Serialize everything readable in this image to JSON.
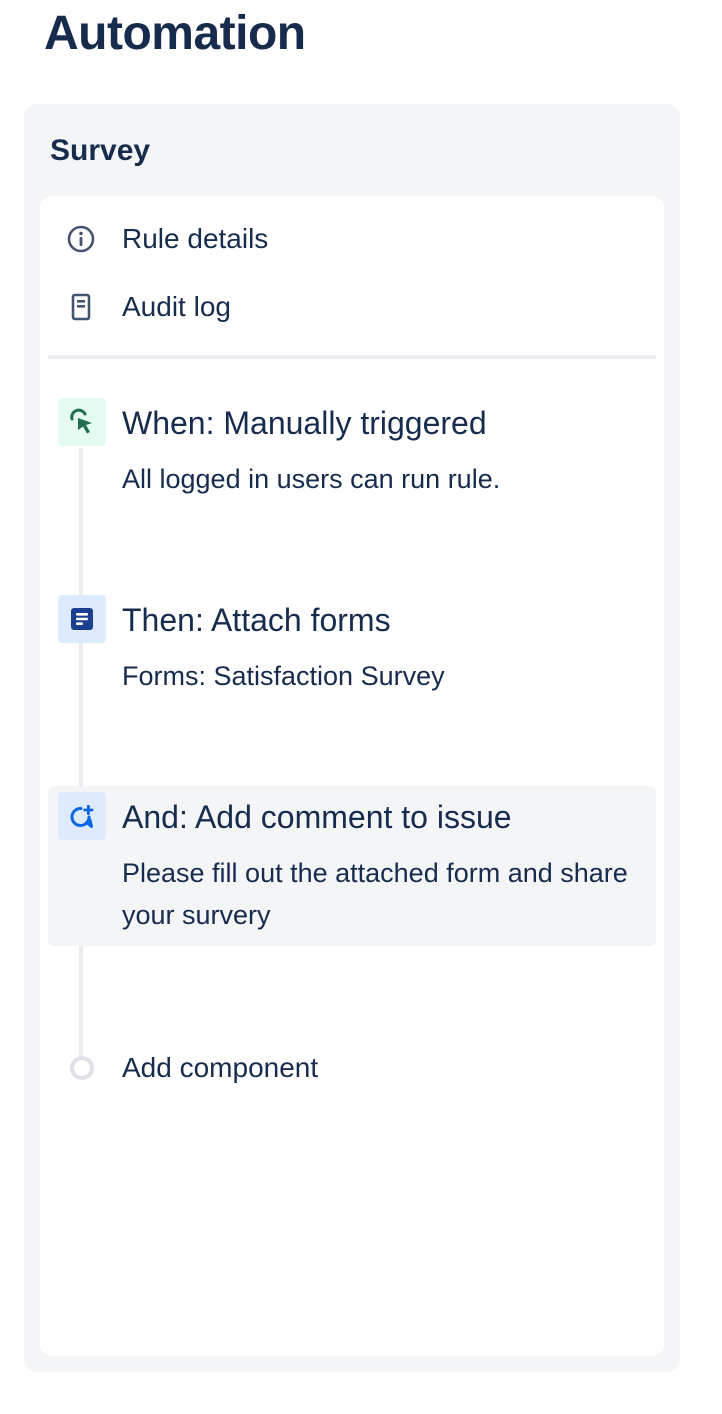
{
  "page": {
    "title": "Automation"
  },
  "rule": {
    "name": "Survey",
    "nav": [
      {
        "label": "Rule details",
        "icon": "info-icon"
      },
      {
        "label": "Audit log",
        "icon": "document-icon"
      }
    ],
    "steps": [
      {
        "title": "When: Manually triggered",
        "description": "All logged in users can run rule.",
        "icon": "cursor-trigger-icon",
        "color": "#e3fcef"
      },
      {
        "title": "Then: Attach forms",
        "description": "Forms: Satisfaction Survey",
        "icon": "form-icon",
        "color": "#deebff"
      },
      {
        "title": "And: Add comment to issue",
        "description": "Please fill out the attached form and share your survery",
        "icon": "add-comment-icon",
        "color": "#deebff"
      }
    ],
    "add_component_label": "Add component"
  },
  "colors": {
    "text": "#172b4d",
    "panel_bg": "#f4f5f7",
    "trigger_green": "#216e4e",
    "action_blue": "#0c66e4"
  }
}
